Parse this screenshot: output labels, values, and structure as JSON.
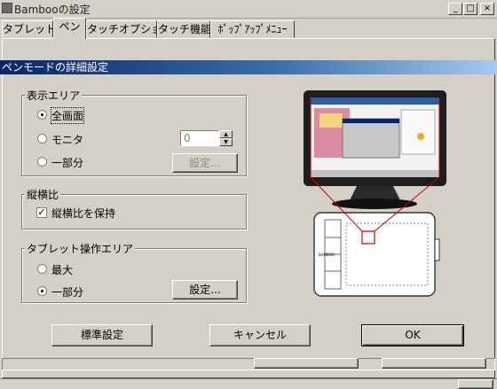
{
  "window": {
    "title": "Bambooの設定",
    "minimize": "_",
    "maximize": "□",
    "close": "×"
  },
  "tabs": [
    {
      "label": "タブレット",
      "selected": false
    },
    {
      "label": "ペン",
      "selected": true
    },
    {
      "label": "タッチオプション",
      "selected": false
    },
    {
      "label": "タッチ機能",
      "selected": false
    },
    {
      "label": "ﾎﾟｯﾌﾟｱｯﾌﾟﾒﾆｭｰ",
      "selected": false
    }
  ],
  "section": {
    "title": "ペンモードの詳細設定"
  },
  "display_area": {
    "title": "表示エリア",
    "options": [
      {
        "label": "全画面",
        "selected": true
      },
      {
        "label": "モニタ",
        "selected": false
      },
      {
        "label": "一部分",
        "selected": false
      }
    ],
    "monitor_value": "0",
    "settings_button": "設定..."
  },
  "aspect": {
    "title": "縦横比",
    "checkbox_label": "縦横比を保持",
    "checked": true,
    "check_glyph": "✓"
  },
  "tablet_area": {
    "title": "タブレット操作エリア",
    "options": [
      {
        "label": "最大",
        "selected": false
      },
      {
        "label": "一部分",
        "selected": true
      }
    ],
    "settings_button": "設定..."
  },
  "preview": {
    "tablet_brand": "BAMBOO"
  },
  "footer": {
    "defaults_button": "標準設定",
    "cancel_button": "キャンセル",
    "ok_button": "OK"
  },
  "colors": {
    "accent_title": "#0a246a",
    "mapping_lines": "#cc0000",
    "monitor_bezel": "#1e1e1e"
  }
}
